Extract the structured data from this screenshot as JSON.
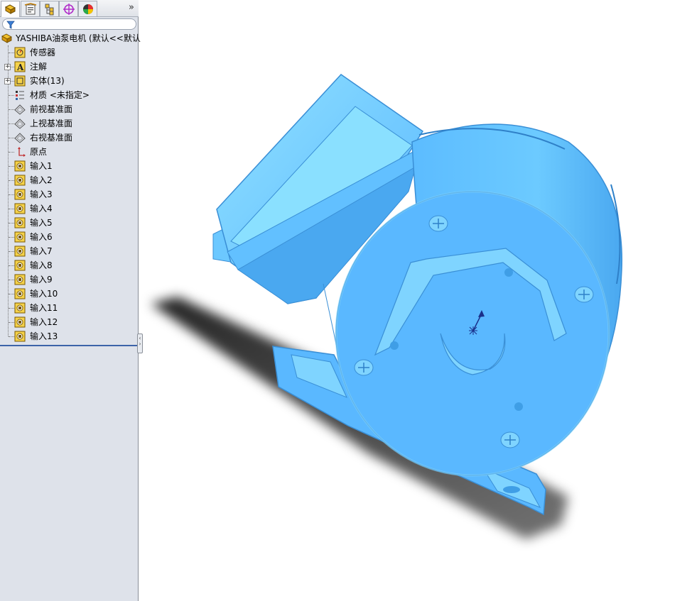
{
  "tree": {
    "root_label": "YASHIBA油泵电机  (默认<<默认",
    "items": [
      {
        "label": "传感器",
        "icon": "sensor-icon",
        "expandable": false
      },
      {
        "label": "注解",
        "icon": "annotation-icon",
        "expandable": true
      },
      {
        "label": "实体(13)",
        "icon": "solid-bodies-icon",
        "expandable": true
      },
      {
        "label": "材质 <未指定>",
        "icon": "material-icon",
        "expandable": false
      },
      {
        "label": "前视基准面",
        "icon": "plane-icon",
        "expandable": false
      },
      {
        "label": "上视基准面",
        "icon": "plane-icon",
        "expandable": false
      },
      {
        "label": "右视基准面",
        "icon": "plane-icon",
        "expandable": false
      },
      {
        "label": "原点",
        "icon": "origin-icon",
        "expandable": false
      },
      {
        "label": "输入1",
        "icon": "imported-feature-icon",
        "expandable": false
      },
      {
        "label": "输入2",
        "icon": "imported-feature-icon",
        "expandable": false
      },
      {
        "label": "输入3",
        "icon": "imported-feature-icon",
        "expandable": false
      },
      {
        "label": "输入4",
        "icon": "imported-feature-icon",
        "expandable": false
      },
      {
        "label": "输入5",
        "icon": "imported-feature-icon",
        "expandable": false
      },
      {
        "label": "输入6",
        "icon": "imported-feature-icon",
        "expandable": false
      },
      {
        "label": "输入7",
        "icon": "imported-feature-icon",
        "expandable": false
      },
      {
        "label": "输入8",
        "icon": "imported-feature-icon",
        "expandable": false
      },
      {
        "label": "输入9",
        "icon": "imported-feature-icon",
        "expandable": false
      },
      {
        "label": "输入10",
        "icon": "imported-feature-icon",
        "expandable": false
      },
      {
        "label": "输入11",
        "icon": "imported-feature-icon",
        "expandable": false
      },
      {
        "label": "输入12",
        "icon": "imported-feature-icon",
        "expandable": false
      },
      {
        "label": "输入13",
        "icon": "imported-feature-icon",
        "expandable": false
      }
    ]
  },
  "tabs": [
    {
      "name": "feature-manager-tab"
    },
    {
      "name": "property-manager-tab"
    },
    {
      "name": "configuration-manager-tab"
    },
    {
      "name": "dimxpert-manager-tab"
    },
    {
      "name": "display-manager-tab"
    }
  ],
  "tab_overflow_glyph": "»",
  "colors": {
    "model": "#5ab8ff",
    "model_light": "#7fd4ff",
    "model_dark": "#3a8fd6",
    "panel_bg": "#dee2ea"
  }
}
